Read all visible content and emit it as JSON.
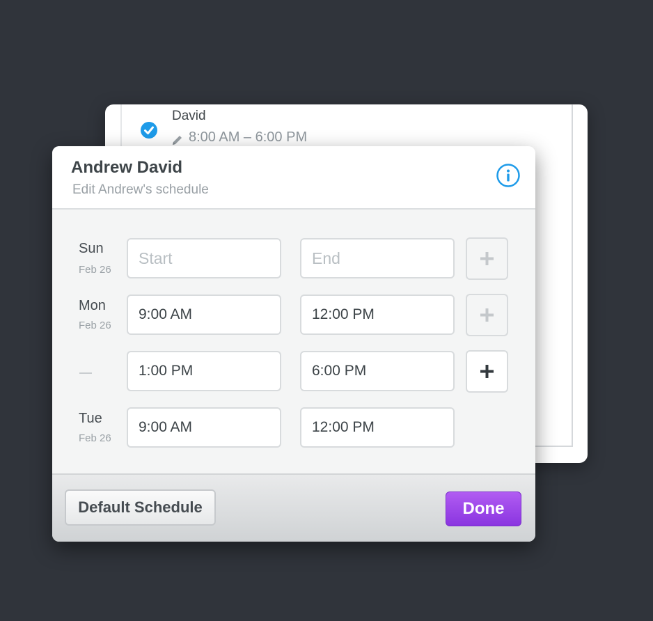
{
  "back_card": {
    "name": "David",
    "time": "8:00 AM – 6:00 PM"
  },
  "dialog": {
    "title": "Andrew David",
    "subtitle": "Edit Andrew's schedule"
  },
  "rows": [
    {
      "day": "Sun",
      "date": "Feb 26",
      "start": "",
      "end": "",
      "start_placeholder": "Start",
      "end_placeholder": "End"
    },
    {
      "day": "Mon",
      "date": "Feb 26",
      "start": "9:00 AM",
      "end": "12:00 PM"
    },
    {
      "day": "",
      "date": "",
      "start": "1:00 PM",
      "end": "6:00 PM"
    },
    {
      "day": "Tue",
      "date": "Feb 26",
      "start": "9:00 AM",
      "end": "12:00 PM"
    }
  ],
  "footer": {
    "default_label": "Default Schedule",
    "done_label": "Done"
  },
  "colors": {
    "accent": "#1e9be9",
    "done": "#9b45e8",
    "background": "#30343b"
  },
  "icons": [
    "check-circle-icon",
    "pencil-icon",
    "info-icon",
    "plus-icon"
  ]
}
